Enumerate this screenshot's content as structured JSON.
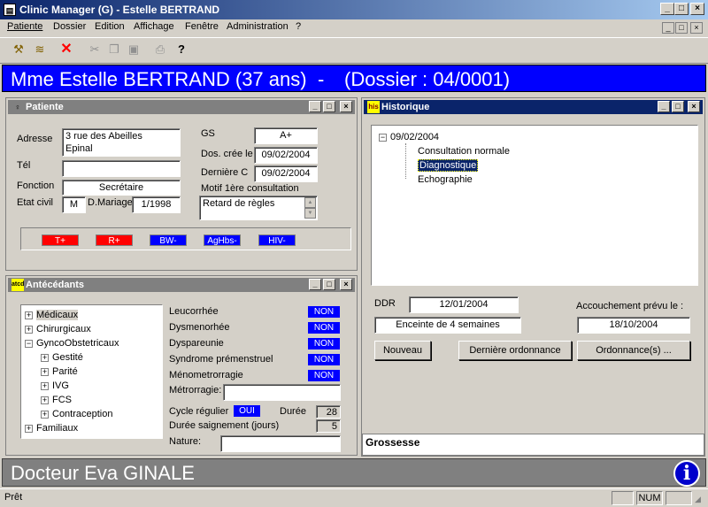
{
  "window": {
    "title": "Clinic Manager (G) - Estelle BERTRAND"
  },
  "menu": [
    "Patiente",
    "Dossier",
    "Edition",
    "Affichage",
    "Fenêtre",
    "Administration",
    "?"
  ],
  "patient_banner": {
    "name": "Mme Estelle BERTRAND (37 ans)",
    "separator": "-",
    "dossier": "(Dossier : 04/0001)"
  },
  "patiente": {
    "title": "Patiente",
    "adresse_label": "Adresse",
    "adresse_line1": "3 rue des Abeilles",
    "adresse_line2": "Epinal",
    "tel_label": "Tél",
    "tel_value": "",
    "fonction_label": "Fonction",
    "fonction_value": "Secrétaire",
    "etat_civil_label": "Etat civil",
    "etat_civil_value": "M",
    "d_mariage_label": "D.Mariage",
    "d_mariage_value": "1/1998",
    "gs_label": "GS",
    "gs_value": "A+",
    "dos_cree_label": "Dos. crée le",
    "dos_cree_value": "09/02/2004",
    "derniere_c_label": "Dernière C",
    "derniere_c_value": "09/02/2004",
    "motif_label": "Motif 1ère consultation",
    "motif_value": "Retard de règles",
    "tags": [
      {
        "label": "T+",
        "color": "#ff0000"
      },
      {
        "label": "R+",
        "color": "#ff0000"
      },
      {
        "label": "BW-",
        "color": "#0000ff"
      },
      {
        "label": "AgHbs-",
        "color": "#0000ff"
      },
      {
        "label": "HIV-",
        "color": "#0000ff"
      }
    ]
  },
  "antecedants": {
    "title": "Antécédants",
    "tree": [
      "Médicaux",
      "Chirurgicaux",
      "GyncoObstetricaux",
      "Gestité",
      "Parité",
      "IVG",
      "FCS",
      "Contraception",
      "Familiaux"
    ],
    "fields": [
      {
        "label": "Leucorrhée",
        "value": "NON"
      },
      {
        "label": "Dysmenorhée",
        "value": "NON"
      },
      {
        "label": "Dyspareunie",
        "value": "NON"
      },
      {
        "label": "Syndrome prémenstruel",
        "value": "NON"
      },
      {
        "label": "Ménometrorragie",
        "value": "NON"
      }
    ],
    "metrorragie_label": "Métrorragie:",
    "metrorragie_value": "",
    "cycle_label": "Cycle régulier",
    "cycle_value": "OUI",
    "duree_label": "Durée",
    "duree_value": "28",
    "duree_saignement_label": "Durée saignement (jours)",
    "duree_saignement_value": "5",
    "nature_label": "Nature:",
    "nature_value": ""
  },
  "historique": {
    "title": "Historique",
    "tree": {
      "date": "09/02/2004",
      "items": [
        "Consultation normale",
        "Diagnostique",
        "Echographie"
      ],
      "selected": "Diagnostique"
    },
    "ddr_label": "DDR",
    "ddr_value": "12/01/2004",
    "enceinte_value": "Enceinte de 4 semaines",
    "accouchement_label": "Accouchement prévu le :",
    "accouchement_value": "18/10/2004",
    "buttons": {
      "nouveau": "Nouveau",
      "derniere": "Dernière ordonnance",
      "ordonnances": "Ordonnance(s) ..."
    },
    "status_text": "Grossesse"
  },
  "footer_banner": {
    "doctor": "Docteur Eva GINALE"
  },
  "statusbar": {
    "text": "Prêt",
    "num": "NUM"
  },
  "colors": {
    "banner": "#0000ff",
    "title_active": "#0a246a",
    "title_inactive": "#808080"
  }
}
